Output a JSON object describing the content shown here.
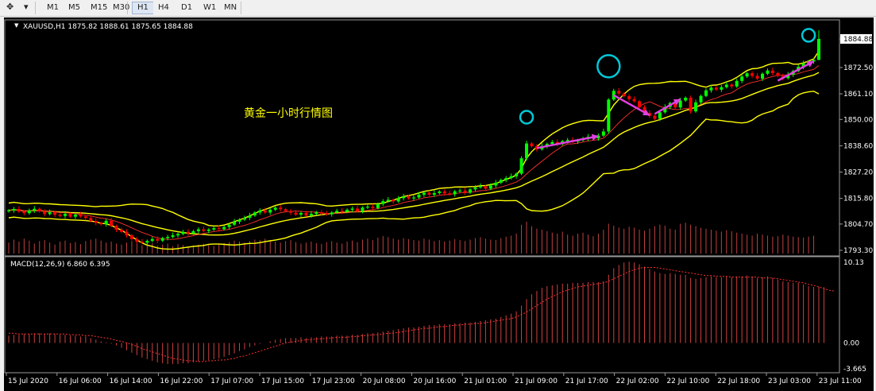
{
  "toolbar": {
    "timeframes": [
      "M1",
      "M5",
      "M15",
      "M30",
      "H1",
      "H4",
      "D1",
      "W1",
      "MN"
    ],
    "active_timeframe": "H1"
  },
  "chart_data": [
    {
      "type": "candlestick",
      "header": "XAUUSD,H1  1875.82 1888.61 1875.65 1884.88",
      "symbol": "XAUUSD",
      "timeframe": "H1",
      "ohlc_last": {
        "open": 1875.82,
        "high": 1888.61,
        "low": 1875.65,
        "close": 1884.88
      },
      "annotation": "黄金一小时行情图",
      "price_axis_labels": [
        "1884.88",
        "1872.50",
        "1861.10",
        "1850.00",
        "1838.60",
        "1827.20",
        "1815.80",
        "1804.70",
        "1793.30"
      ],
      "ylim": [
        1793.3,
        1888.6
      ],
      "time_axis_labels": [
        "15 Jul 2020",
        "16 Jul 06:00",
        "16 Jul 14:00",
        "16 Jul 22:00",
        "17 Jul 07:00",
        "17 Jul 15:00",
        "17 Jul 23:00",
        "20 Jul 08:00",
        "20 Jul 16:00",
        "21 Jul 01:00",
        "21 Jul 09:00",
        "21 Jul 17:00",
        "22 Jul 02:00",
        "22 Jul 10:00",
        "22 Jul 18:00",
        "23 Jul 03:00",
        "23 Jul 11:00"
      ],
      "close_series": [
        1810.6,
        1811.2,
        1810.1,
        1809.4,
        1810.5,
        1811.3,
        1810.2,
        1809.0,
        1809.8,
        1808.7,
        1808.2,
        1809.1,
        1807.9,
        1808.8,
        1808.0,
        1807.3,
        1806.0,
        1805.2,
        1804.6,
        1806.1,
        1803.9,
        1802.2,
        1801.3,
        1799.8,
        1798.2,
        1797.0,
        1796.6,
        1797.4,
        1798.2,
        1797.5,
        1798.6,
        1799.1,
        1799.8,
        1800.4,
        1801.3,
        1800.6,
        1801.6,
        1802.4,
        1801.7,
        1802.3,
        1802.9,
        1802.5,
        1803.4,
        1804.4,
        1805.7,
        1806.6,
        1807.4,
        1808.4,
        1809.7,
        1810.6,
        1809.7,
        1810.9,
        1811.8,
        1811.1,
        1810.3,
        1809.6,
        1808.8,
        1809.5,
        1808.4,
        1809.1,
        1809.8,
        1809.2,
        1808.9,
        1809.7,
        1810.4,
        1810.0,
        1810.9,
        1811.4,
        1810.3,
        1811.8,
        1812.2,
        1811.6,
        1813.4,
        1814.6,
        1815.2,
        1814.5,
        1815.9,
        1816.6,
        1815.8,
        1816.2,
        1817.4,
        1818.3,
        1817.4,
        1818.1,
        1818.8,
        1818.0,
        1817.6,
        1818.9,
        1819.2,
        1818.3,
        1819.7,
        1820.6,
        1821.1,
        1820.0,
        1821.4,
        1822.6,
        1823.8,
        1824.6,
        1825.4,
        1826.5,
        1833.2,
        1839.6,
        1838.4,
        1837.1,
        1838.5,
        1839.4,
        1840.2,
        1839.3,
        1840.6,
        1841.1,
        1840.4,
        1841.0,
        1841.6,
        1842.5,
        1841.8,
        1843.0,
        1844.8,
        1858.6,
        1862.4,
        1861.2,
        1860.1,
        1858.8,
        1857.9,
        1855.3,
        1852.8,
        1851.6,
        1850.3,
        1853.1,
        1855.4,
        1857.1,
        1855.2,
        1858.2,
        1859.4,
        1853.5,
        1857.4,
        1860.2,
        1862.6,
        1863.8,
        1862.9,
        1864.0,
        1865.1,
        1864.3,
        1866.7,
        1868.6,
        1870.0,
        1868.9,
        1867.7,
        1869.8,
        1871.2,
        1870.1,
        1868.9,
        1867.9,
        1869.4,
        1871.0,
        1872.8,
        1874.3,
        1875.1,
        1875.8,
        1884.88
      ],
      "volume_series": [
        22,
        28,
        24,
        30,
        26,
        20,
        25,
        27,
        22,
        18,
        24,
        26,
        21,
        23,
        19,
        25,
        28,
        30,
        26,
        22,
        24,
        20,
        18,
        22,
        25,
        20,
        17,
        19,
        21,
        16,
        18,
        20,
        15,
        19,
        17,
        14,
        16,
        18,
        20,
        17,
        15,
        19,
        21,
        23,
        26,
        24,
        22,
        25,
        28,
        27,
        30,
        26,
        24,
        22,
        25,
        27,
        23,
        20,
        22,
        24,
        21,
        19,
        23,
        25,
        22,
        20,
        24,
        26,
        23,
        28,
        30,
        27,
        32,
        35,
        33,
        30,
        28,
        31,
        29,
        27,
        26,
        30,
        28,
        25,
        27,
        24,
        26,
        29,
        27,
        25,
        28,
        31,
        33,
        30,
        28,
        27,
        31,
        34,
        36,
        40,
        58,
        64,
        55,
        50,
        48,
        45,
        42,
        40,
        44,
        38,
        36,
        40,
        42,
        38,
        35,
        40,
        48,
        60,
        56,
        52,
        50,
        54,
        52,
        48,
        46,
        50,
        55,
        58,
        56,
        50,
        48,
        60,
        62,
        58,
        55,
        52,
        50,
        48,
        46,
        44,
        47,
        45,
        42,
        40,
        38,
        36,
        40,
        38,
        36,
        34,
        35,
        38,
        36,
        34,
        33,
        32,
        34,
        36
      ],
      "indicators": [
        "Bollinger Bands (yellow)",
        "Moving Average (red)"
      ]
    },
    {
      "type": "bar",
      "header": "MACD(12,26,9) 6.860 6.395",
      "title": "MACD(12,26,9)",
      "macd_value": 6.86,
      "signal_value": 6.395,
      "axis_labels": [
        "10.13",
        "0.00",
        "-3.665"
      ],
      "ylim": [
        -3.665,
        10.13
      ],
      "histogram": [
        0.9,
        1.0,
        1.0,
        1.1,
        1.1,
        1.2,
        1.2,
        1.1,
        1.2,
        1.1,
        1.0,
        1.0,
        0.9,
        0.9,
        0.8,
        0.8,
        0.6,
        0.4,
        0.2,
        0.1,
        -0.1,
        -0.3,
        -0.6,
        -0.9,
        -1.2,
        -1.5,
        -1.8,
        -2.0,
        -2.2,
        -2.4,
        -2.5,
        -2.6,
        -2.6,
        -2.6,
        -2.5,
        -2.5,
        -2.4,
        -2.3,
        -2.2,
        -2.1,
        -2.0,
        -1.9,
        -1.7,
        -1.5,
        -1.3,
        -1.0,
        -0.8,
        -0.5,
        -0.3,
        -0.1,
        0.0,
        0.2,
        0.4,
        0.5,
        0.6,
        0.6,
        0.6,
        0.7,
        0.6,
        0.7,
        0.7,
        0.8,
        0.8,
        0.8,
        0.9,
        0.9,
        0.9,
        1.0,
        1.0,
        1.1,
        1.2,
        1.2,
        1.3,
        1.4,
        1.5,
        1.6,
        1.7,
        1.8,
        1.9,
        1.9,
        2.0,
        2.1,
        2.2,
        2.2,
        2.3,
        2.3,
        2.3,
        2.4,
        2.4,
        2.5,
        2.5,
        2.6,
        2.7,
        2.8,
        2.9,
        3.0,
        3.2,
        3.4,
        3.6,
        3.9,
        4.6,
        5.4,
        6.0,
        6.4,
        6.8,
        7.0,
        7.1,
        7.2,
        7.3,
        7.3,
        7.4,
        7.4,
        7.4,
        7.5,
        7.5,
        7.5,
        7.6,
        8.4,
        9.2,
        9.6,
        9.9,
        10.0,
        9.9,
        9.7,
        9.4,
        9.1,
        8.8,
        8.6,
        8.5,
        8.6,
        8.5,
        8.4,
        8.4,
        8.0,
        7.9,
        8.0,
        8.1,
        8.2,
        8.1,
        8.1,
        8.2,
        8.1,
        8.2,
        8.2,
        8.3,
        8.2,
        8.0,
        8.1,
        8.2,
        8.0,
        7.8,
        7.6,
        7.5,
        7.4,
        7.4,
        7.2,
        7.0,
        6.9,
        6.9,
        6.86
      ],
      "signal_series": [
        1.2,
        1.2,
        1.1,
        1.1,
        1.1,
        1.1,
        1.1,
        1.1,
        1.1,
        1.1,
        1.1,
        1.1,
        1.0,
        1.0,
        1.0,
        0.9,
        0.9,
        0.8,
        0.7,
        0.6,
        0.5,
        0.3,
        0.2,
        0.0,
        -0.2,
        -0.4,
        -0.7,
        -0.9,
        -1.1,
        -1.3,
        -1.5,
        -1.7,
        -1.9,
        -2.0,
        -2.1,
        -2.2,
        -2.2,
        -2.3,
        -2.3,
        -2.2,
        -2.2,
        -2.1,
        -2.1,
        -2.0,
        -1.9,
        -1.7,
        -1.6,
        -1.4,
        -1.2,
        -1.0,
        -0.8,
        -0.6,
        -0.4,
        -0.2,
        0.0,
        0.1,
        0.2,
        0.3,
        0.4,
        0.4,
        0.5,
        0.5,
        0.6,
        0.6,
        0.7,
        0.7,
        0.7,
        0.8,
        0.8,
        0.9,
        0.9,
        1.0,
        1.0,
        1.1,
        1.2,
        1.2,
        1.3,
        1.4,
        1.5,
        1.6,
        1.7,
        1.8,
        1.8,
        1.9,
        2.0,
        2.0,
        2.1,
        2.2,
        2.2,
        2.3,
        2.3,
        2.4,
        2.4,
        2.5,
        2.6,
        2.7,
        2.8,
        2.9,
        3.0,
        3.2,
        3.5,
        3.8,
        4.2,
        4.6,
        5.0,
        5.4,
        5.7,
        6.0,
        6.3,
        6.5,
        6.7,
        6.9,
        7.0,
        7.1,
        7.2,
        7.3,
        7.4,
        7.6,
        7.9,
        8.2,
        8.5,
        8.8,
        9.0,
        9.2,
        9.3,
        9.3,
        9.3,
        9.2,
        9.1,
        9.0,
        8.9,
        8.8,
        8.7,
        8.6,
        8.5,
        8.4,
        8.3,
        8.3,
        8.2,
        8.2,
        8.2,
        8.1,
        8.1,
        8.1,
        8.1,
        8.1,
        8.1,
        8.0,
        8.0,
        8.0,
        7.9,
        7.8,
        7.7,
        7.6,
        7.5,
        7.4,
        7.2,
        7.1,
        6.9,
        6.7,
        6.5,
        6.395
      ]
    }
  ],
  "markers": {
    "circles": 3,
    "arrows": 4,
    "circle_color": "#00c8d8",
    "arrow_color": "#e040e0"
  },
  "colors": {
    "background": "#000000",
    "bull": "#00ff00",
    "bear": "#ff0000",
    "bollinger": "#ffff00",
    "ma": "#ff3030",
    "volume": "#c04040",
    "macd_hist": "#d04040",
    "text": "#ffffff"
  }
}
